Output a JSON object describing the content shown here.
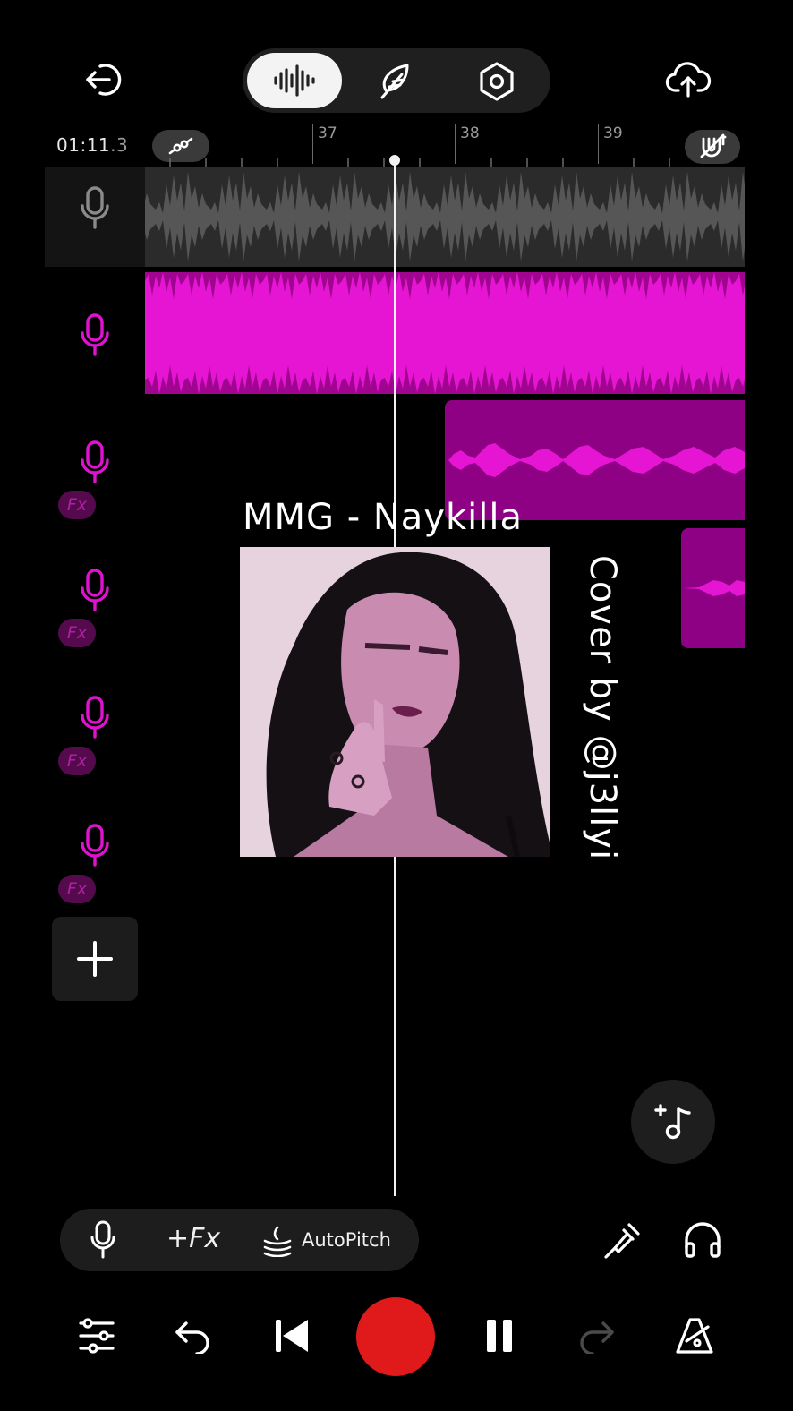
{
  "header": {
    "back_icon": "exit-icon",
    "modes": [
      {
        "name": "waveform",
        "icon": "waveform-icon",
        "selected": true
      },
      {
        "name": "feather",
        "icon": "feather-icon",
        "selected": false
      },
      {
        "name": "settings",
        "icon": "hexagon-settings-icon",
        "selected": false
      }
    ],
    "upload_icon": "cloud-upload-icon"
  },
  "timeline": {
    "time_main": "01:11",
    "time_fraction": ".3",
    "bar_labels": [
      "37",
      "38",
      "39"
    ],
    "automation_icon": "automation-icon",
    "snap_icon": "snap-magnet-icon"
  },
  "tracks": [
    {
      "id": 1,
      "icon": "mic-icon",
      "fx": false,
      "color": "#8a8a8a"
    },
    {
      "id": 2,
      "icon": "mic-icon",
      "fx": false,
      "color": "#e011cf"
    },
    {
      "id": 3,
      "icon": "mic-icon",
      "fx": true,
      "color": "#e011cf"
    },
    {
      "id": 4,
      "icon": "mic-icon",
      "fx": true,
      "color": "#e011cf"
    },
    {
      "id": 5,
      "icon": "mic-icon",
      "fx": true,
      "color": "#e011cf"
    },
    {
      "id": 6,
      "icon": "mic-icon",
      "fx": true,
      "color": "#e011cf"
    }
  ],
  "fx_label": "Fx",
  "overlay": {
    "title": "MMG - Naykilla",
    "credit": "Cover by @j3llyi"
  },
  "toolbar": {
    "fx_button": "+Fx",
    "autopitch_button": "AutoPitch"
  },
  "colors": {
    "accent": "#e011cf",
    "record": "#e01a1a",
    "background": "#000000"
  }
}
